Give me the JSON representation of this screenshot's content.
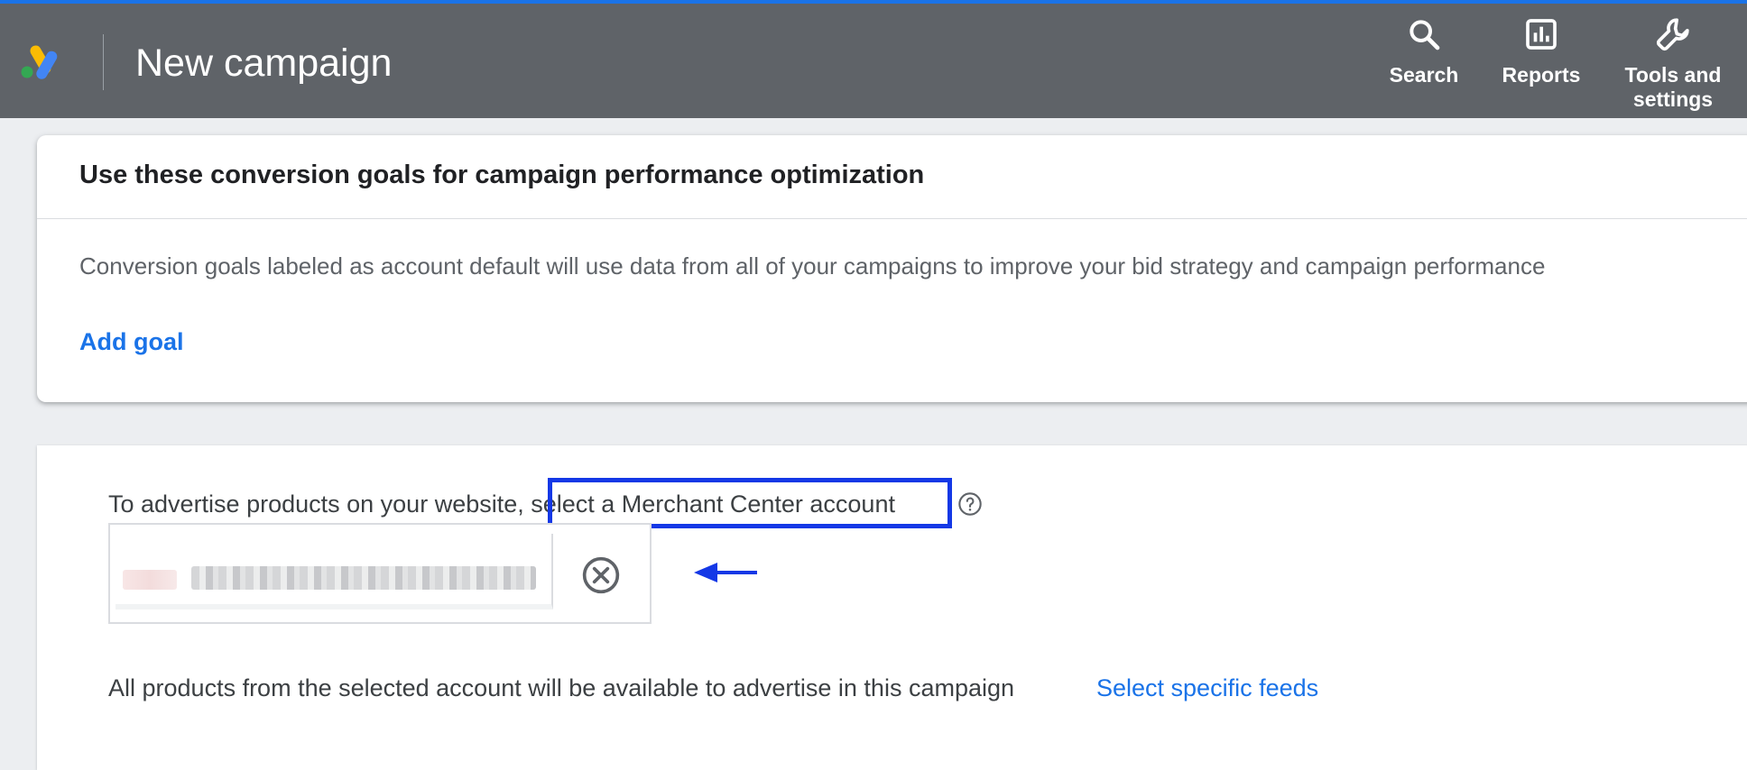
{
  "header": {
    "title": "New campaign",
    "actions": [
      {
        "label": "Search",
        "icon": "search-icon"
      },
      {
        "label": "Reports",
        "icon": "reports-icon"
      },
      {
        "label": "Tools and settings",
        "icon": "wrench-icon"
      }
    ]
  },
  "goals_card": {
    "title": "Use these conversion goals for campaign performance optimization",
    "description": "Conversion goals labeled as account default will use data from all of your campaigns to improve your bid strategy and campaign performance",
    "add_goal_label": "Add goal"
  },
  "merchant_card": {
    "intro_text": "To advertise products on your website, ",
    "link_text": "select a Merchant Center account",
    "products_text": "All products from the selected account will be available to advertise in this campaign",
    "feeds_link": "Select specific feeds"
  },
  "colors": {
    "header_bg": "#5f6368",
    "accent_blue": "#1a73e8",
    "annotation_blue": "#1438e6",
    "page_bg": "#eceef1"
  }
}
